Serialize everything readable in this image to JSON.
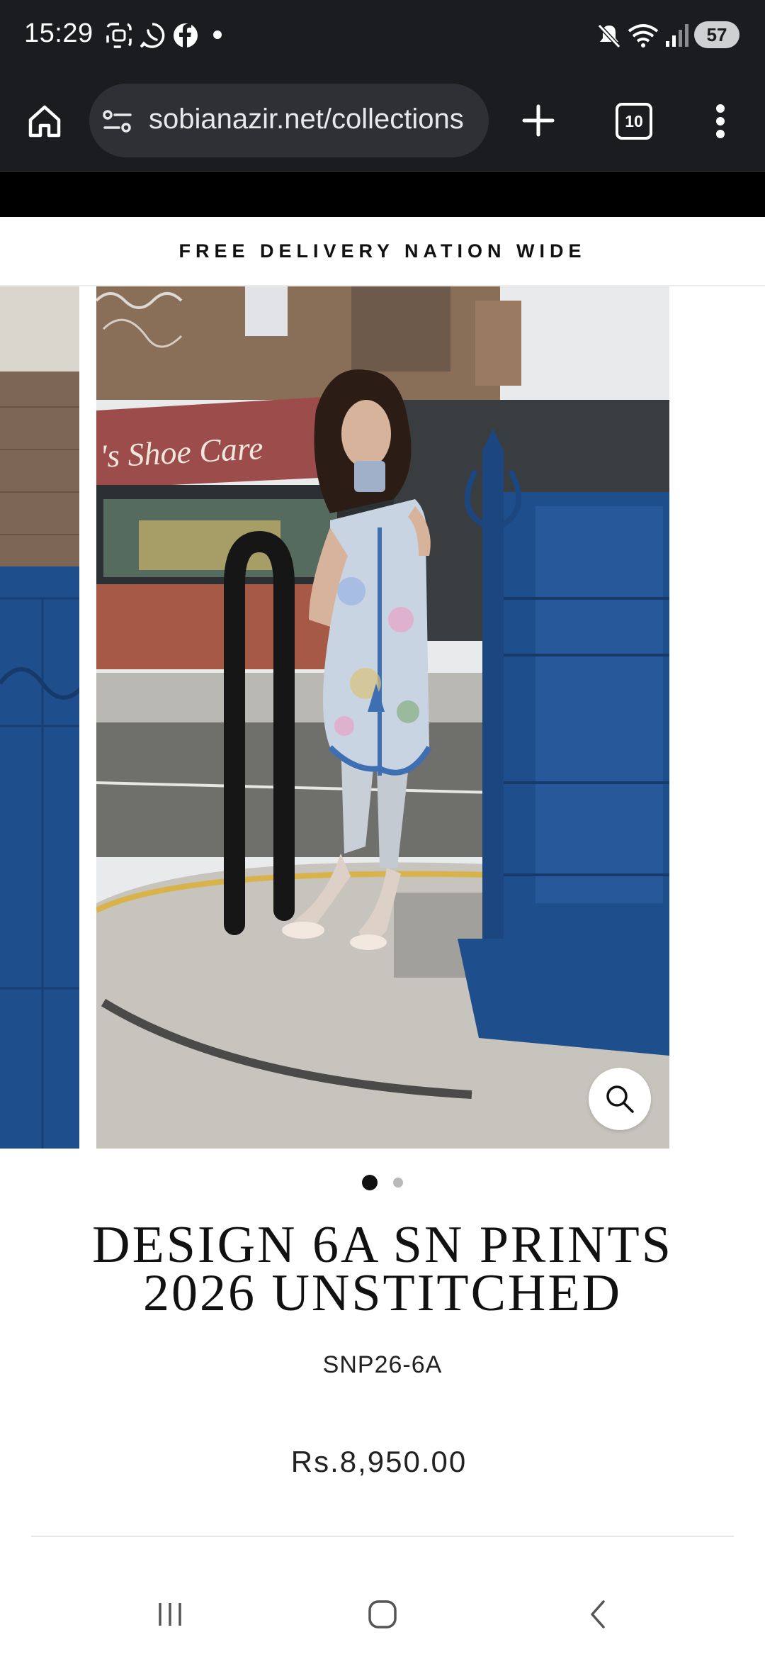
{
  "status_bar": {
    "time": "15:29",
    "battery": "57",
    "left_icons": [
      "screenshot-icon",
      "whatsapp-icon",
      "facebook-icon",
      "notification-dot-icon"
    ],
    "right_icons": [
      "mute-icon",
      "wifi-icon",
      "signal-icon",
      "battery-icon"
    ]
  },
  "browser": {
    "url": "sobianazir.net/collections",
    "tab_count": "10",
    "icons": [
      "home-icon",
      "site-settings-icon",
      "new-tab-icon",
      "tab-switcher-icon",
      "more-menu-icon"
    ]
  },
  "announcement": {
    "text": "FREE DELIVERY NATION WIDE"
  },
  "gallery": {
    "total_slides": 2,
    "active_slide": 1,
    "storefront_sign": "'s Shoe Care",
    "zoom_icon": "magnifier-icon"
  },
  "product": {
    "title": "DESIGN 6A SN PRINTS 2026 UNSTITCHED",
    "sku": "SNP26-6A",
    "price": "Rs.8,950.00"
  },
  "nav": {
    "icons": [
      "recent-apps-icon",
      "home-button-icon",
      "back-icon"
    ]
  },
  "colors": {
    "system_bar": "#1b1c20",
    "url_pill": "#2e3036",
    "text": "#111111",
    "gate_blue": "#1f4e8c"
  }
}
